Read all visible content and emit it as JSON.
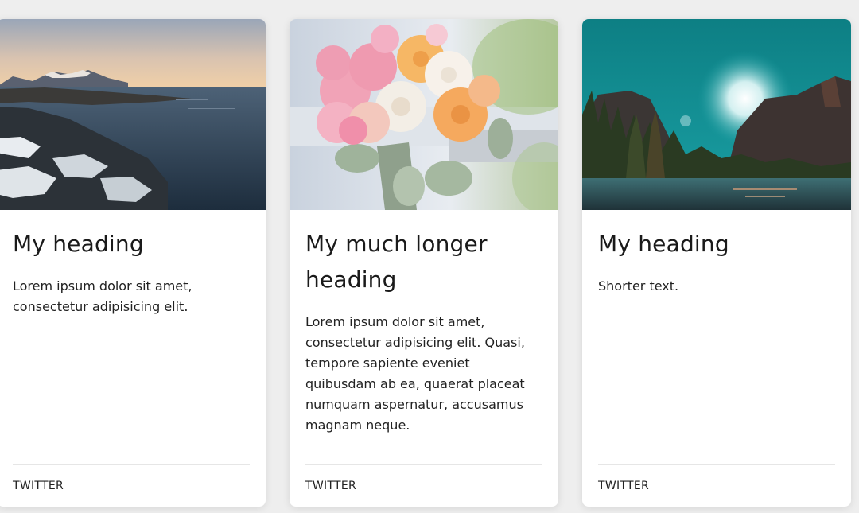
{
  "cards": [
    {
      "image": "coastal-rocks-sunset-photo",
      "heading": "My heading",
      "text": "Lorem ipsum dolor sit amet, consectetur adipisicing elit.",
      "link": "TWITTER"
    },
    {
      "image": "flower-bouquet-photo",
      "heading": "My much longer heading",
      "text": "Lorem ipsum dolor sit amet, consectetur adipisicing elit. Quasi, tempore sapiente eveniet quibusdam ab ea, quaerat placeat numquam aspernatur, accusamus magnam neque.",
      "link": "TWITTER"
    },
    {
      "image": "valley-sunburst-photo",
      "heading": "My heading",
      "text": "Shorter text.",
      "link": "TWITTER"
    }
  ],
  "colors": {
    "page_background": "#eeeeee",
    "card_background": "#ffffff",
    "text": "#222222",
    "divider": "#e6e6e6"
  }
}
